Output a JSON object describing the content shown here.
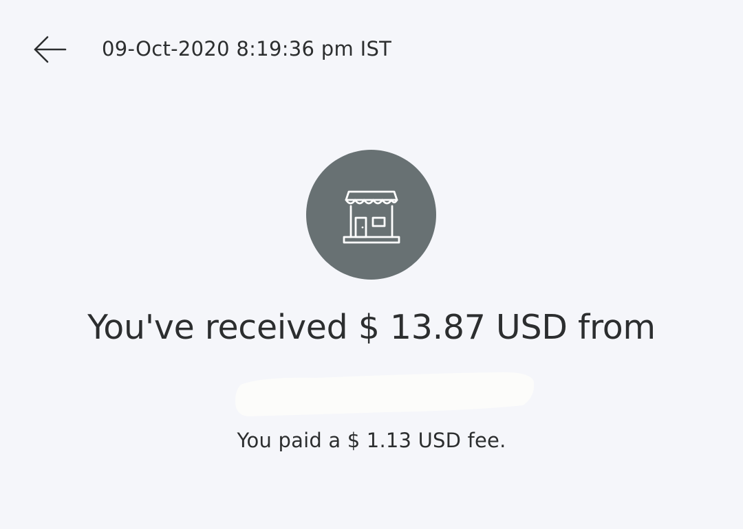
{
  "header": {
    "back_icon": "arrow-left-icon",
    "timestamp": "09-Oct-2020 8:19:36 pm IST"
  },
  "merchant": {
    "icon": "storefront-icon",
    "avatar_color": "#687173"
  },
  "transaction": {
    "headline": "You've received $ 13.87 USD from",
    "fee_text": "You paid a $ 1.13 USD fee."
  },
  "colors": {
    "background": "#f5f6fa",
    "text": "#2c2e2f",
    "redaction": "#fcfcfa"
  }
}
